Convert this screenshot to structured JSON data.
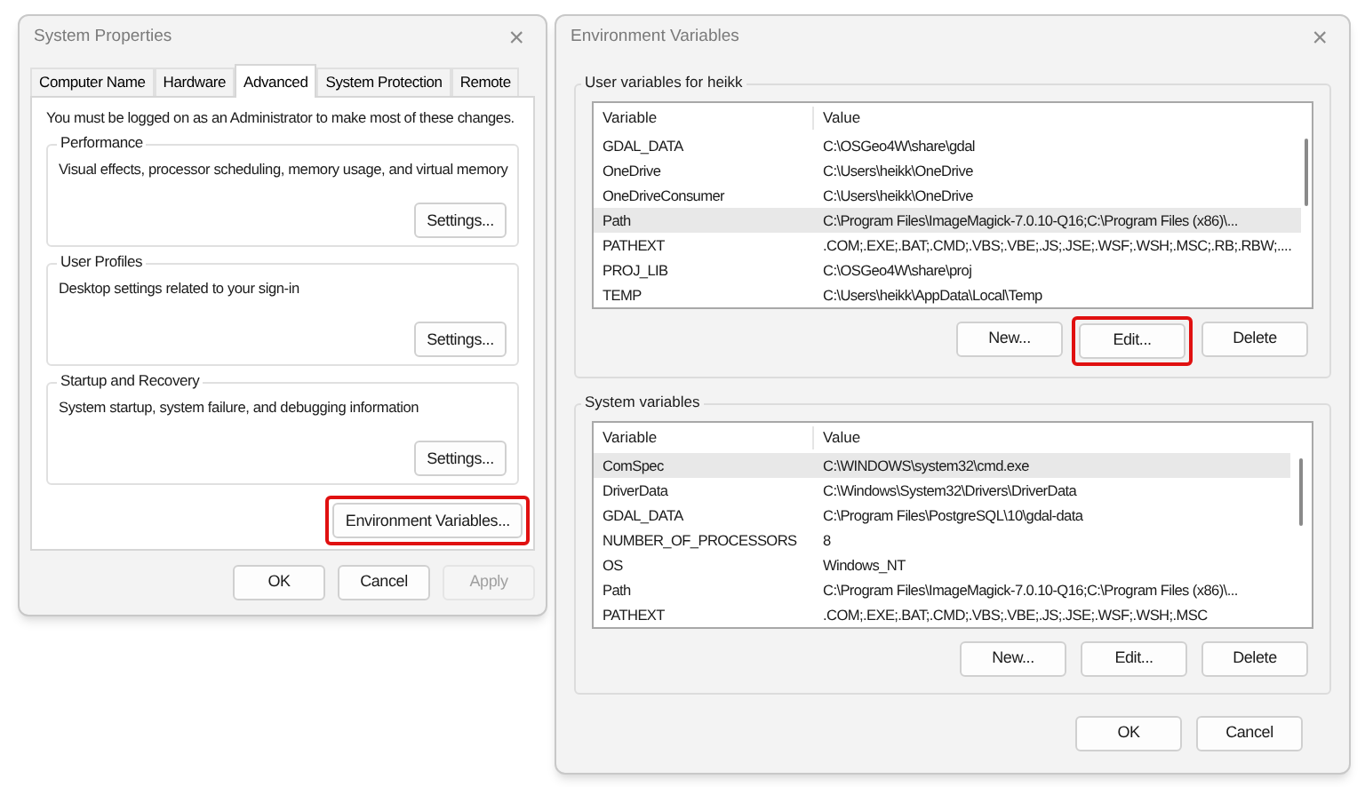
{
  "system_properties": {
    "title": "System Properties",
    "close": "×",
    "tabs": [
      {
        "label": "Computer Name",
        "selected": false
      },
      {
        "label": "Hardware",
        "selected": false
      },
      {
        "label": "Advanced",
        "selected": true
      },
      {
        "label": "System Protection",
        "selected": false
      },
      {
        "label": "Remote",
        "selected": false
      }
    ],
    "notice": "You must be logged on as an Administrator to make most of these changes.",
    "groups": [
      {
        "title": "Performance",
        "description": "Visual effects, processor scheduling, memory usage, and virtual memory",
        "button": "Settings..."
      },
      {
        "title": "User Profiles",
        "description": "Desktop settings related to your sign-in",
        "button": "Settings..."
      },
      {
        "title": "Startup and Recovery",
        "description": "System startup, system failure, and debugging information",
        "button": "Settings..."
      }
    ],
    "env_button": {
      "label": "Environment Variables...",
      "highlighted": true
    },
    "footer_buttons": [
      {
        "label": "OK",
        "disabled": false
      },
      {
        "label": "Cancel",
        "disabled": false
      },
      {
        "label": "Apply",
        "disabled": true
      }
    ]
  },
  "environment_variables": {
    "title": "Environment Variables",
    "close": "×",
    "sections": [
      {
        "title": "User variables for heikk",
        "columns": [
          "Variable",
          "Value"
        ],
        "rows": [
          {
            "variable": "GDAL_DATA",
            "value": "C:\\OSGeo4W\\share\\gdal",
            "selected": false
          },
          {
            "variable": "OneDrive",
            "value": "C:\\Users\\heikk\\OneDrive",
            "selected": false
          },
          {
            "variable": "OneDriveConsumer",
            "value": "C:\\Users\\heikk\\OneDrive",
            "selected": false
          },
          {
            "variable": "Path",
            "value": "C:\\Program Files\\ImageMagick-7.0.10-Q16;C:\\Program Files (x86)\\...",
            "selected": true
          },
          {
            "variable": "PATHEXT",
            "value": ".COM;.EXE;.BAT;.CMD;.VBS;.VBE;.JS;.JSE;.WSF;.WSH;.MSC;.RB;.RBW;....",
            "selected": false
          },
          {
            "variable": "PROJ_LIB",
            "value": "C:\\OSGeo4W\\share\\proj",
            "selected": false
          },
          {
            "variable": "TEMP",
            "value": "C:\\Users\\heikk\\AppData\\Local\\Temp",
            "selected": false
          }
        ],
        "buttons": [
          {
            "label": "New...",
            "highlighted": false
          },
          {
            "label": "Edit...",
            "highlighted": true
          },
          {
            "label": "Delete",
            "highlighted": false
          }
        ]
      },
      {
        "title": "System variables",
        "columns": [
          "Variable",
          "Value"
        ],
        "rows": [
          {
            "variable": "ComSpec",
            "value": "C:\\WINDOWS\\system32\\cmd.exe",
            "selected": true
          },
          {
            "variable": "DriverData",
            "value": "C:\\Windows\\System32\\Drivers\\DriverData",
            "selected": false
          },
          {
            "variable": "GDAL_DATA",
            "value": "C:\\Program Files\\PostgreSQL\\10\\gdal-data",
            "selected": false
          },
          {
            "variable": "NUMBER_OF_PROCESSORS",
            "value": "8",
            "selected": false
          },
          {
            "variable": "OS",
            "value": "Windows_NT",
            "selected": false
          },
          {
            "variable": "Path",
            "value": "C:\\Program Files\\ImageMagick-7.0.10-Q16;C:\\Program Files (x86)\\...",
            "selected": false
          },
          {
            "variable": "PATHEXT",
            "value": ".COM;.EXE;.BAT;.CMD;.VBS;.VBE;.JS;.JSE;.WSF;.WSH;.MSC",
            "selected": false
          }
        ],
        "buttons": [
          {
            "label": "New...",
            "highlighted": false
          },
          {
            "label": "Edit...",
            "highlighted": false
          },
          {
            "label": "Delete",
            "highlighted": false
          }
        ]
      }
    ],
    "footer_buttons": [
      {
        "label": "OK",
        "disabled": false
      },
      {
        "label": "Cancel",
        "disabled": false
      }
    ]
  }
}
